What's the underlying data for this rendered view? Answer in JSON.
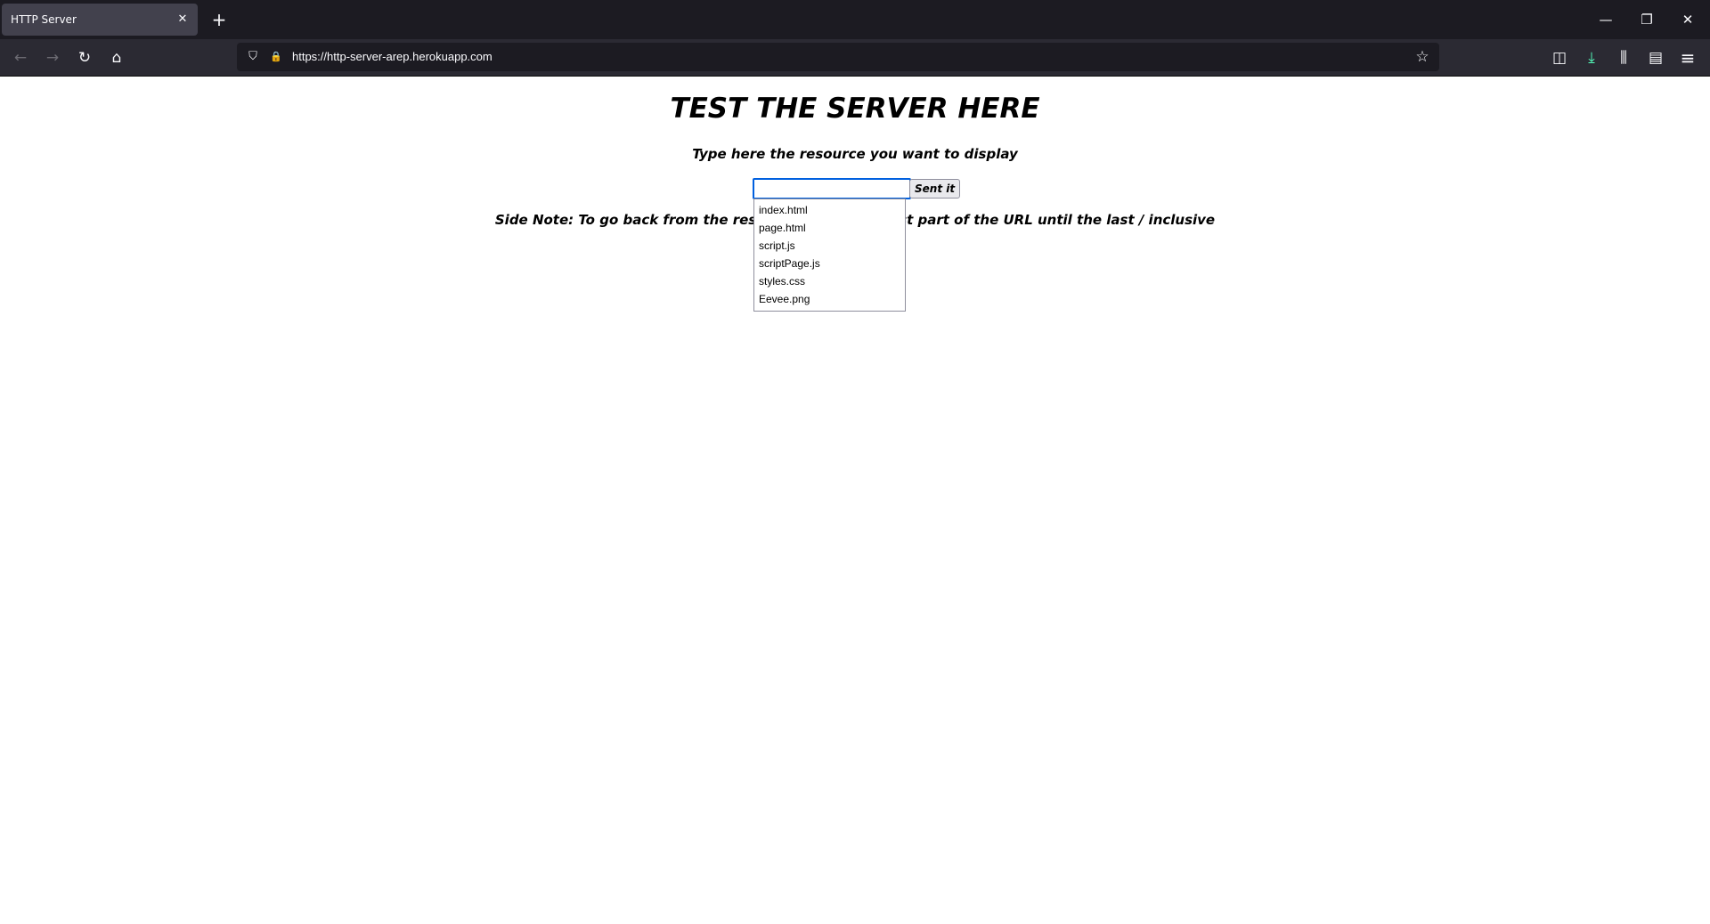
{
  "browser": {
    "tab_title": "HTTP Server",
    "tab_close_glyph": "✕",
    "new_tab_glyph": "+",
    "window_controls": {
      "minimize": "—",
      "restore": "❐",
      "close": "✕"
    },
    "nav": {
      "back": "←",
      "forward": "→",
      "reload": "↻",
      "home": "⌂"
    },
    "url": "https://http-server-arep.herokuapp.com",
    "url_icons": {
      "shield": "⛉",
      "lock": "🔒"
    },
    "bookmark_glyph": "☆",
    "toolbar_icons": {
      "pocket": "◫",
      "downloads": "⤓",
      "library": "⫼",
      "sidebar": "▤",
      "menu": "≡"
    },
    "accent_color": "#0060df",
    "download_icon_color": "#54ffbd"
  },
  "page": {
    "title": "TEST THE SERVER HERE",
    "subtitle": "Type here the resource you want to display",
    "input": {
      "value": "",
      "placeholder": ""
    },
    "submit_label": "Sent it",
    "side_note": "Side Note: To go back from the resource delete the last part of the URL until the last / inclusive",
    "suggestions": [
      "index.html",
      "page.html",
      "script.js",
      "scriptPage.js",
      "styles.css",
      "Eevee.png"
    ]
  }
}
